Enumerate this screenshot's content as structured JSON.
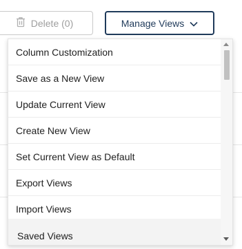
{
  "toolbar": {
    "delete_label": "Delete (0)",
    "delete_icon": "trash-icon",
    "manage_views_label": "Manage Views",
    "manage_views_icon": "chevron-down-icon",
    "accent_color": "#1f3a5a"
  },
  "menu": {
    "items": [
      {
        "label": "Column Customization"
      },
      {
        "label": "Save as a New View"
      },
      {
        "label": "Update Current View"
      },
      {
        "label": "Create New View"
      },
      {
        "label": "Set Current View as Default"
      },
      {
        "label": "Export Views"
      },
      {
        "label": "Import Views"
      }
    ],
    "section_header": "Saved Views"
  }
}
